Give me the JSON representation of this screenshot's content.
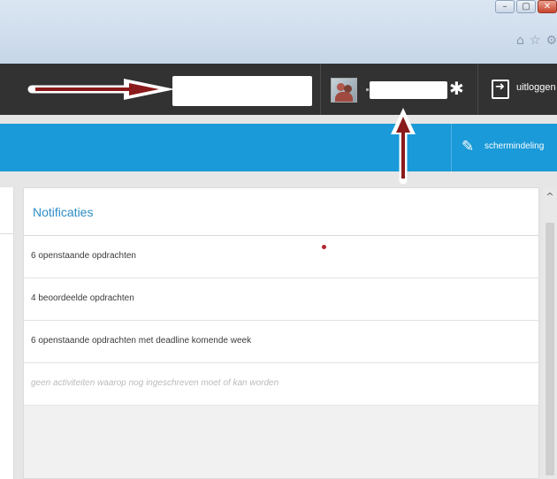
{
  "window_controls": {
    "minimize": "–",
    "maximize": "▢",
    "close": "✕"
  },
  "browser_icons": {
    "home": "⌂",
    "star": "☆",
    "settings": "⚙"
  },
  "topbar": {
    "gear_glyph": "✱",
    "logout_label": "uitloggen"
  },
  "bluebar": {
    "pencil_glyph": "✎",
    "layout_label": "schermindeling"
  },
  "panel": {
    "title": "Notificaties",
    "items": [
      {
        "text": "6 openstaande opdrachten"
      },
      {
        "text": "4 beoordeelde opdrachten"
      },
      {
        "text": "6 openstaande opdrachten met deadline komende week"
      },
      {
        "text": "geen activiteiten waarop nog ingeschreven moet of kan worden"
      }
    ]
  },
  "scrollbar": {
    "up_glyph": "^"
  },
  "colors": {
    "topbar": "#323232",
    "bluebar": "#1a9ad8",
    "title": "#2c8ec6",
    "annotation_arrow": "#8b1a1a"
  }
}
